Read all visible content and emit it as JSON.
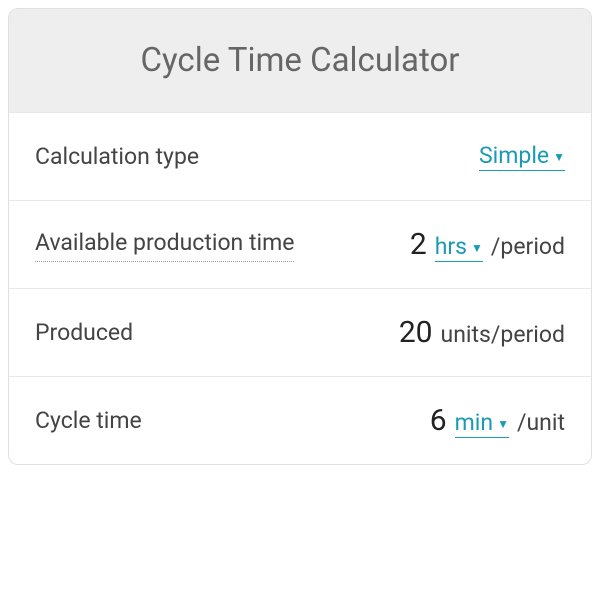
{
  "title": "Cycle Time Calculator",
  "rows": {
    "calcType": {
      "label": "Calculation type",
      "value": "Simple"
    },
    "availTime": {
      "label": "Available production time",
      "value": "2",
      "unit": "hrs",
      "suffix": "/period"
    },
    "produced": {
      "label": "Produced",
      "value": "20",
      "unit": "units/period"
    },
    "cycleTime": {
      "label": "Cycle time",
      "value": "6",
      "unit": "min",
      "suffix": "/unit"
    }
  },
  "chart_data": {
    "type": "table",
    "title": "Cycle Time Calculator",
    "rows": [
      {
        "field": "Calculation type",
        "value": "Simple"
      },
      {
        "field": "Available production time",
        "value": 2,
        "unit": "hrs/period"
      },
      {
        "field": "Produced",
        "value": 20,
        "unit": "units/period"
      },
      {
        "field": "Cycle time",
        "value": 6,
        "unit": "min/unit"
      }
    ]
  }
}
